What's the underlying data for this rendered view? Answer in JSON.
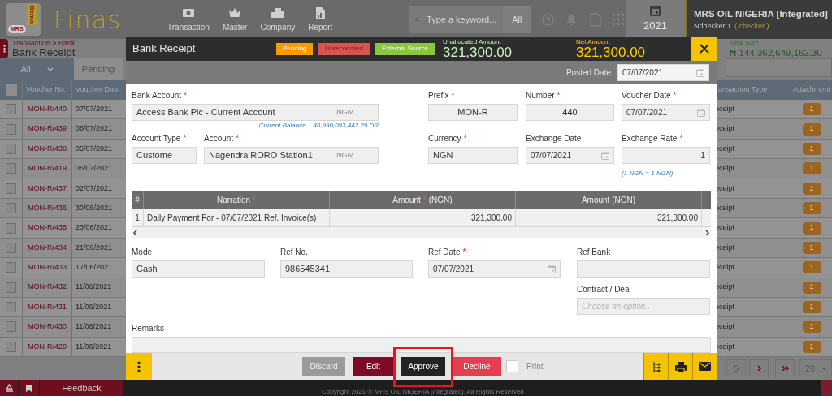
{
  "app": {
    "logo_mark": "MRS",
    "logo_badge": "Demo",
    "logo_text": "Finas"
  },
  "nav": [
    {
      "label": "Transaction"
    },
    {
      "label": "Master"
    },
    {
      "label": "Company"
    },
    {
      "label": "Report"
    }
  ],
  "search": {
    "placeholder": "Type a keyword...",
    "scope": "All"
  },
  "year": "2021",
  "company": "MRS OIL NIGERIA [Integrated]",
  "user": "Ndhecker 1",
  "role": "( checker )",
  "breadcrumb": "Transaction > Bank",
  "page_title": "Bank Receipt",
  "tabs": [
    {
      "label": "All",
      "selected": true
    },
    {
      "label": "Pending",
      "selected": false
    }
  ],
  "total": {
    "label": "Total Sum",
    "value": "₦ 144,362,649,162.30"
  },
  "table": {
    "all_checked": false,
    "columns": [
      "Voucher No.",
      "Voucher Date",
      "ransaction Type",
      "Attachment"
    ],
    "rows": [
      {
        "checked": false,
        "voucher_no": "MON-R/440",
        "voucher_date": "07/07/2021",
        "type": "eceipt",
        "attachment": "1"
      },
      {
        "checked": false,
        "voucher_no": "MON-R/439",
        "voucher_date": "06/07/2021",
        "type": "eceipt",
        "attachment": "1"
      },
      {
        "checked": false,
        "voucher_no": "MON-R/438",
        "voucher_date": "05/07/2021",
        "type": "eceipt",
        "attachment": "1"
      },
      {
        "checked": false,
        "voucher_no": "MON-R/419",
        "voucher_date": "05/07/2021",
        "type": "eceipt",
        "attachment": "1"
      },
      {
        "checked": false,
        "voucher_no": "MON-R/437",
        "voucher_date": "02/07/2021",
        "type": "eceipt",
        "attachment": "1"
      },
      {
        "checked": false,
        "voucher_no": "MON-R/436",
        "voucher_date": "30/06/2021",
        "type": "eceipt",
        "attachment": "1"
      },
      {
        "checked": false,
        "voucher_no": "MON-R/435",
        "voucher_date": "23/06/2021",
        "type": "eceipt",
        "attachment": "1"
      },
      {
        "checked": false,
        "voucher_no": "MON-R/434",
        "voucher_date": "21/06/2021",
        "type": "eceipt",
        "attachment": "1"
      },
      {
        "checked": false,
        "voucher_no": "MON-R/433",
        "voucher_date": "17/06/2021",
        "type": "eceipt",
        "attachment": "1"
      },
      {
        "checked": false,
        "voucher_no": "MON-R/432",
        "voucher_date": "11/06/2021",
        "type": "eceipt",
        "attachment": "1"
      },
      {
        "checked": false,
        "voucher_no": "MON-R/431",
        "voucher_date": "11/06/2021",
        "type": "eceipt",
        "attachment": "1"
      },
      {
        "checked": false,
        "voucher_no": "MON-R/430",
        "voucher_date": "11/06/2021",
        "type": "eceipt",
        "attachment": "1"
      },
      {
        "checked": false,
        "voucher_no": "MON-R/429",
        "voucher_date": "11/06/2021",
        "type": "eceipt",
        "attachment": "1"
      }
    ]
  },
  "pagination": {
    "pages": [
      {
        "label": "5",
        "selected": false
      }
    ],
    "page_size": "20"
  },
  "modal": {
    "title": "Bank Receipt",
    "required_mark": "*",
    "badges": [
      {
        "label": "Pending",
        "color": "#ff9900"
      },
      {
        "label": "Unreconciled",
        "color": "#d9534f"
      },
      {
        "label": "External Source",
        "color": "#8cc63e"
      }
    ],
    "amounts": [
      {
        "label": "Unallocated Amount",
        "value": "321,300.00",
        "color": "#c8f5c0"
      },
      {
        "label": "Net Amount",
        "value": "321,300.00",
        "color": "#ffcc00"
      }
    ],
    "posted_date": {
      "label": "Posted Date",
      "value": "07/07/2021"
    },
    "form_rows": [
      [
        {
          "label": "Bank Account",
          "required": true,
          "kind": "text",
          "value": "Access Bank Plc - Current Account",
          "suffix": "NGN",
          "note": "Current Balance    46,990,093,442.29 DR"
        },
        {
          "label": "Prefix",
          "required": true,
          "kind": "text",
          "value": "MON-R"
        },
        {
          "label": "Number",
          "required": true,
          "kind": "text",
          "value": "440"
        },
        {
          "label": "Voucher Date",
          "required": true,
          "kind": "date",
          "value": "07/07/2021"
        }
      ],
      [
        {
          "label": "Account Type",
          "required": true,
          "kind": "text",
          "value": "Custome"
        },
        {
          "label": "Account",
          "required": true,
          "kind": "text",
          "value": "Nagendra RORO Station1",
          "suffix": "NGN"
        },
        {
          "label": "Currency",
          "required": true,
          "kind": "text",
          "value": "NGN"
        },
        {
          "label": "Exchange Date",
          "required": false,
          "kind": "date",
          "value": "07/07/2021"
        },
        {
          "label": "Exchange Rate",
          "required": true,
          "kind": "text",
          "value": "1",
          "note": "(1 NGN = 1 NGN)"
        }
      ]
    ],
    "grid": {
      "columns": [
        {
          "label": "#",
          "required": false
        },
        {
          "label": "Narration",
          "required": true
        },
        {
          "label": "Amount",
          "required": true,
          "unit": "(NGN)"
        },
        {
          "label": "Amount (NGN)",
          "required": false
        }
      ],
      "rows": [
        [
          "1",
          "Daily Payment For - 07/07/2021 Ref. Invoice(s)",
          "321,300.00",
          "321,300.00"
        ]
      ]
    },
    "ref_row": [
      {
        "label": "Mode",
        "required": false,
        "kind": "text",
        "value": "Cash"
      },
      {
        "label": "Ref No.",
        "required": false,
        "kind": "text",
        "value": "986545341"
      },
      {
        "label": "Ref Date",
        "required": true,
        "kind": "date",
        "value": "07/07/2021"
      },
      {
        "label": "Ref Bank",
        "required": false,
        "kind": "text"
      }
    ],
    "contract": {
      "label": "Contract / Deal",
      "placeholder": "Choose an option.."
    },
    "remarks": {
      "label": "Remarks"
    },
    "actions": [
      {
        "label": "Discard",
        "kind": "discard",
        "highlighted": false
      },
      {
        "label": "Edit",
        "kind": "edit",
        "highlighted": false
      },
      {
        "label": "Approve",
        "kind": "approve",
        "highlighted": true
      },
      {
        "label": "Decline",
        "kind": "decline",
        "highlighted": false
      }
    ],
    "print": {
      "label": "Print",
      "checked": false
    }
  },
  "footer": {
    "feedback": "Feedback",
    "copyright": "Copyright 2021 © MRS OIL NIGERIA [Integrated]. All Rights Reserved"
  }
}
